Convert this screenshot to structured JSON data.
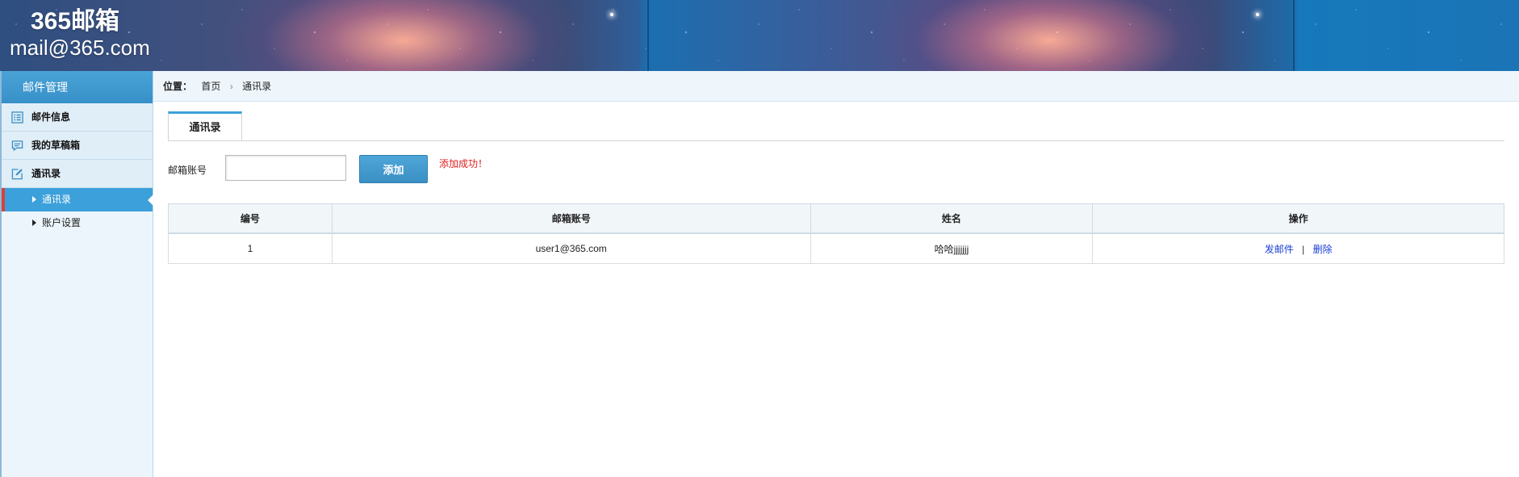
{
  "header": {
    "brand_name": "365邮箱",
    "brand_email": "mail@365.com"
  },
  "sidebar": {
    "title": "邮件管理",
    "items": [
      {
        "label": "邮件信息",
        "icon": "list-icon"
      },
      {
        "label": "我的草稿箱",
        "icon": "chat-icon"
      },
      {
        "label": "通讯录",
        "icon": "edit-icon"
      }
    ],
    "subitems": [
      {
        "label": "通讯录",
        "active": true
      },
      {
        "label": "账户设置",
        "active": false
      }
    ]
  },
  "breadcrumb": {
    "label": "位置：",
    "home": "首页",
    "separator": "›",
    "current": "通讯录"
  },
  "tabs": [
    {
      "label": "通讯录",
      "active": true
    }
  ],
  "form": {
    "account_label": "邮箱账号",
    "account_value": "",
    "add_button": "添加",
    "success_message": "添加成功！"
  },
  "table": {
    "headers": [
      "编号",
      "邮箱账号",
      "姓名",
      "操作"
    ],
    "rows": [
      {
        "id": "1",
        "email": "user1@365.com",
        "name": "哈哈jjjjjjj",
        "actions": {
          "send": "发邮件",
          "separator": "|",
          "delete": "删除"
        }
      }
    ]
  },
  "colors": {
    "accent": "#3ca0da",
    "active_marker": "#d8413c",
    "success_text": "#e02020",
    "link": "#1a3fd6"
  }
}
